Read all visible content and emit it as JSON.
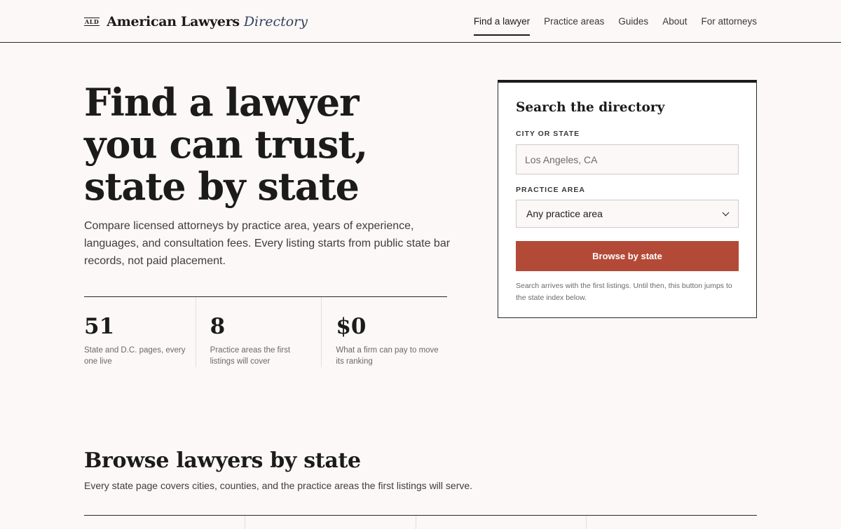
{
  "header": {
    "brand_mark": "ALD",
    "brand_name": "American Lawyers",
    "brand_name_em": "Directory",
    "nav": [
      {
        "label": "Find a lawyer",
        "active": true
      },
      {
        "label": "Practice areas",
        "active": false
      },
      {
        "label": "Guides",
        "active": false
      },
      {
        "label": "About",
        "active": false
      },
      {
        "label": "For attorneys",
        "active": false
      }
    ]
  },
  "hero": {
    "title_line1": "Find a lawyer",
    "title_line2": "you can trust,",
    "title_line3": "state by state",
    "lede": "Compare licensed attorneys by practice area, years of experience, languages, and consultation fees. Every listing starts from public state bar records, not paid placement.",
    "stats": [
      {
        "value": "51",
        "label": "State and D.C. pages, every one live"
      },
      {
        "value": "8",
        "label": "Practice areas the first listings will cover"
      },
      {
        "value": "$0",
        "label": "What a firm can pay to move its ranking"
      }
    ]
  },
  "search": {
    "title": "Search the directory",
    "city_label": "CITY OR STATE",
    "city_placeholder": "Los Angeles, CA",
    "practice_label": "PRACTICE AREA",
    "practice_selected": "Any practice area",
    "button_label": "Browse by state",
    "note": "Search arrives with the first listings. Until then, this button jumps to the state index below."
  },
  "browse": {
    "title": "Browse lawyers by state",
    "subtitle": "Every state page covers cities, counties, and the practice areas the first listings will serve."
  },
  "colors": {
    "accent": "#b34a37",
    "brand_em": "#34425e",
    "background": "#fbf8f7"
  }
}
